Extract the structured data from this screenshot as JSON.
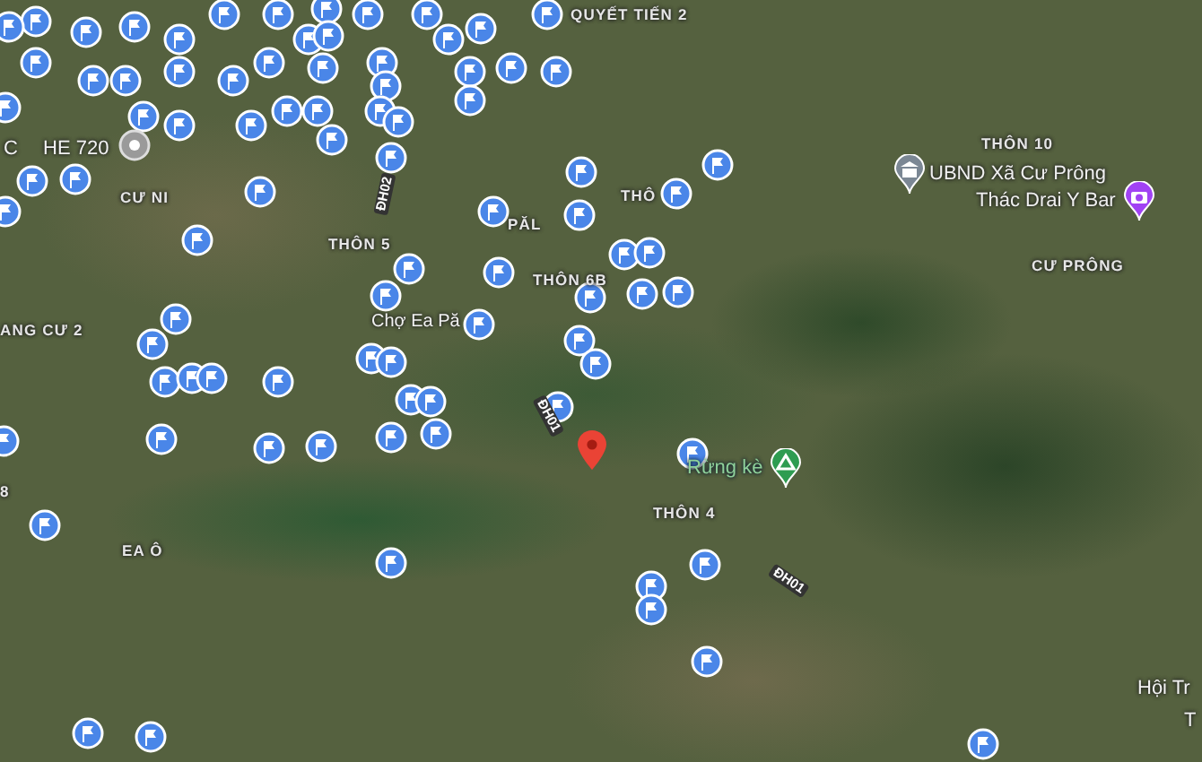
{
  "map": {
    "labels": [
      {
        "text": "QUYẾT TIẾN 2",
        "kind": "area"
      },
      {
        "text": "C",
        "kind": "place"
      },
      {
        "text": "HE 720",
        "kind": "place"
      },
      {
        "text": "THÔN 10",
        "kind": "area"
      },
      {
        "text": "CƯ NI",
        "kind": "area"
      },
      {
        "text": "UBND Xã Cư Prông",
        "kind": "government"
      },
      {
        "text": "THÔ",
        "kind": "area"
      },
      {
        "text": "PĂL",
        "kind": "area"
      },
      {
        "text": "Thác Drai Y Bar",
        "kind": "attraction"
      },
      {
        "text": "THÔN 5",
        "kind": "area"
      },
      {
        "text": "THÔN 6B",
        "kind": "area"
      },
      {
        "text": "CƯ PRÔNG",
        "kind": "area"
      },
      {
        "text": "Chợ Ea Pă",
        "kind": "place"
      },
      {
        "text": "ANG CƯ 2",
        "kind": "area"
      },
      {
        "text": "ĐH02",
        "kind": "road"
      },
      {
        "text": "ĐH01",
        "kind": "road"
      },
      {
        "text": "8",
        "kind": "area"
      },
      {
        "text": "Rừng kè",
        "kind": "park"
      },
      {
        "text": "THÔN 4",
        "kind": "area"
      },
      {
        "text": "EA Ô",
        "kind": "area"
      },
      {
        "text": "ĐH01",
        "kind": "road"
      },
      {
        "text": "Hội Tr",
        "kind": "place"
      },
      {
        "text": "T",
        "kind": "place"
      }
    ]
  }
}
